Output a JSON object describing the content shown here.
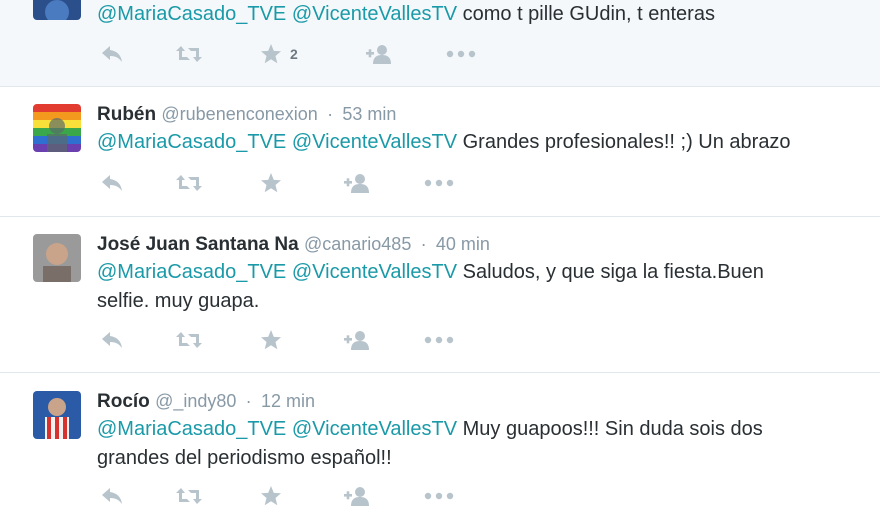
{
  "tweets": [
    {
      "name": "",
      "handle": "",
      "time": "",
      "mentions": [
        "@MariaCasado_TVE",
        "@VicenteVallesTV"
      ],
      "text": "como t pille GUdin, t enteras",
      "text2": "",
      "favorites": "2",
      "avatar_colors": [
        "#2b4f8a",
        "#4a7ac0"
      ]
    },
    {
      "name": "Rubén",
      "handle": "@rubenenconexion",
      "time": "53 min",
      "mentions": [
        "@MariaCasado_TVE",
        "@VicenteVallesTV"
      ],
      "text": "Grandes profesionales!! ;) Un abrazo",
      "text2": "",
      "favorites": "",
      "avatar_colors": [
        "#e23b2f",
        "#f39a1e",
        "#f7e03a",
        "#3aa84a",
        "#2f6fd0",
        "#6a3fb0"
      ]
    },
    {
      "name": "José Juan Santana Na",
      "handle": "@canario485",
      "time": "40 min",
      "mentions": [
        "@MariaCasado_TVE",
        "@VicenteVallesTV"
      ],
      "text": "Saludos, y que siga la fiesta.Buen",
      "text2": "selfie. muy guapa.",
      "favorites": "",
      "avatar_colors": [
        "#8a8a8a",
        "#c9a48a"
      ]
    },
    {
      "name": "Rocío",
      "handle": "@_indy80",
      "time": "12 min",
      "mentions": [
        "@MariaCasado_TVE",
        "@VicenteVallesTV"
      ],
      "text": "Muy guapoos!!! Sin duda sois dos",
      "text2": "grandes del periodismo español!!",
      "favorites": "",
      "avatar_colors": [
        "#2b5aa6",
        "#d8322f",
        "#f2f2f2"
      ]
    }
  ],
  "icons": {
    "reply": "reply-icon",
    "retweet": "retweet-icon",
    "favorite": "star-icon",
    "follow": "follow-icon",
    "more": "more-icon"
  },
  "colors": {
    "mention": "#1a9aa8",
    "muted": "#8899a6",
    "icon": "#b8c4cc",
    "divider": "#e1e8ed"
  }
}
